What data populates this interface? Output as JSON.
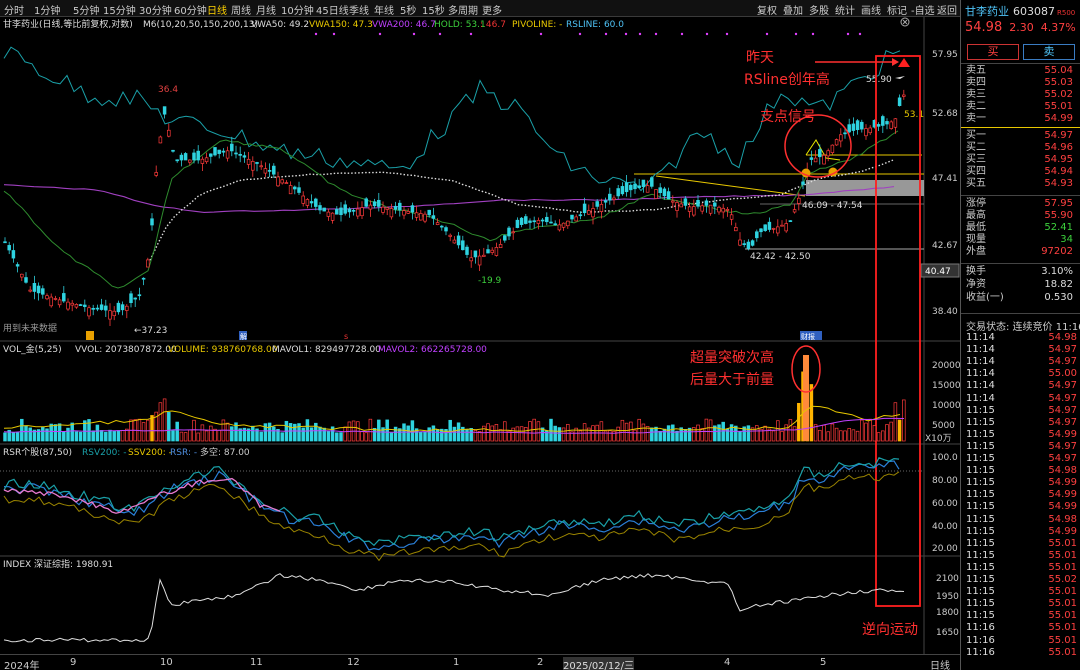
{
  "toolbar": {
    "periods": [
      "分时",
      "1分钟",
      "5分钟",
      "15分钟",
      "30分钟",
      "60分钟",
      "日线",
      "周线",
      "月线",
      "10分钟",
      "45日线",
      "季线",
      "年线",
      "5秒",
      "15秒",
      "多周期",
      "更多"
    ],
    "active": "日线",
    "right": [
      "复权",
      "叠加",
      "多股",
      "统计",
      "画线",
      "标记",
      "-自选",
      "返回"
    ],
    "close_icon": "close-circle-icon"
  },
  "main_legend": {
    "title": "甘李药业(日线,等比前复权,对数)",
    "ma": "M6(10,20,50,150,200,13)",
    "vwa50": "VWA50: 49.2",
    "vwa150": "VWA150: 47.3",
    "vwa200": "VWA200: 46.7",
    "hold": "HOLD: 53.1",
    "hold2": ": 46.7",
    "pivoline": "PIVOLINE: -",
    "rsline": "RSLINE: 60.0"
  },
  "price_axis": [
    "57.95",
    "52.68",
    "47.41",
    "42.67",
    "38.40"
  ],
  "price_tag": "40.47",
  "annotations": {
    "yesterday": "昨天",
    "rsline_high": "RSline创年高",
    "pivot": "支点信号",
    "volume1": "超量突破次高",
    "volume2": "后量大于前量",
    "reverse": "逆向运动"
  },
  "price_labels": {
    "high_left": "36.4",
    "low_left": "←37.23",
    "low_mid": "-19.9",
    "range_upper": "46.09 - 47.54",
    "range_lower": "42.42 - 42.50",
    "recent_high": "55.90",
    "hold_tag": "53.1",
    "future_data": "用到未来数据",
    "mark_jie": "解",
    "mark_caibao": "财报"
  },
  "vol_legend": {
    "title": "VOL_金(5,25)",
    "vvol": "VVOL: 2073807872.00",
    "volume": "VOLUME: 938760768.00",
    "mavol1": "MAVOL1: 829497728.00",
    "mavol2": "MAVOL2: 662265728.00"
  },
  "vol_axis": [
    "20000",
    "15000",
    "10000",
    "5000"
  ],
  "vol_unit": "X10万",
  "rsr_legend": {
    "title": "RSR个股(87,50)",
    "rsv": "RSV200: -",
    "ssv": "SSV200: -",
    "rsr": "RSR: -",
    "ls": "多空: 87.00"
  },
  "rsr_axis": [
    "100.0",
    "80.00",
    "60.00",
    "40.00",
    "20.00"
  ],
  "index_legend": {
    "title": "INDEX 深证综指: 1980.91"
  },
  "index_axis": [
    "2100",
    "1950",
    "1800",
    "1650"
  ],
  "xaxis": [
    "2024年",
    "9",
    "10",
    "11",
    "12",
    "1",
    "2",
    "2025/02/12/三",
    "4",
    "5",
    "日线"
  ],
  "quote": {
    "name": "甘李药业",
    "code": "603087",
    "r500": "R500",
    "price": "54.98",
    "change": "2.30",
    "pct": "4.37%",
    "buy_btn": "买",
    "sell_btn": "卖",
    "asks": [
      {
        "label": "卖五",
        "price": "55.04"
      },
      {
        "label": "卖四",
        "price": "55.03"
      },
      {
        "label": "卖三",
        "price": "55.02"
      },
      {
        "label": "卖二",
        "price": "55.01"
      },
      {
        "label": "卖一",
        "price": "54.99"
      }
    ],
    "bids": [
      {
        "label": "买一",
        "price": "54.97"
      },
      {
        "label": "买二",
        "price": "54.96"
      },
      {
        "label": "买三",
        "price": "54.95"
      },
      {
        "label": "买四",
        "price": "54.94"
      },
      {
        "label": "买五",
        "price": "54.93"
      }
    ],
    "stats1": [
      {
        "label": "涨停",
        "value": "57.95"
      },
      {
        "label": "最高",
        "value": "55.90"
      },
      {
        "label": "最低",
        "value": "52.41"
      },
      {
        "label": "现量",
        "value": "34"
      },
      {
        "label": "外盘",
        "value": "97202"
      }
    ],
    "stats2": [
      {
        "label": "换手",
        "value": "3.10%"
      },
      {
        "label": "净资",
        "value": "18.82"
      },
      {
        "label": "收益(一)",
        "value": "0.530"
      }
    ],
    "status": "交易状态: 连续竞价 11:16"
  },
  "ticks": [
    {
      "t": "11:14",
      "p": "54.98"
    },
    {
      "t": "11:14",
      "p": "54.97"
    },
    {
      "t": "11:14",
      "p": "54.97"
    },
    {
      "t": "11:14",
      "p": "55.00"
    },
    {
      "t": "11:14",
      "p": "54.97"
    },
    {
      "t": "11:14",
      "p": "54.97"
    },
    {
      "t": "11:15",
      "p": "54.97"
    },
    {
      "t": "11:15",
      "p": "54.97"
    },
    {
      "t": "11:15",
      "p": "54.99"
    },
    {
      "t": "11:15",
      "p": "54.97"
    },
    {
      "t": "11:15",
      "p": "54.97"
    },
    {
      "t": "11:15",
      "p": "54.98"
    },
    {
      "t": "11:15",
      "p": "54.99"
    },
    {
      "t": "11:15",
      "p": "54.99"
    },
    {
      "t": "11:15",
      "p": "54.99"
    },
    {
      "t": "11:15",
      "p": "54.98"
    },
    {
      "t": "11:15",
      "p": "54.99"
    },
    {
      "t": "11:15",
      "p": "55.01"
    },
    {
      "t": "11:15",
      "p": "55.01"
    },
    {
      "t": "11:15",
      "p": "55.01"
    },
    {
      "t": "11:15",
      "p": "55.02"
    },
    {
      "t": "11:15",
      "p": "55.01"
    },
    {
      "t": "11:15",
      "p": "55.01"
    },
    {
      "t": "11:15",
      "p": "55.01"
    },
    {
      "t": "11:16",
      "p": "55.01"
    },
    {
      "t": "11:16",
      "p": "55.01"
    },
    {
      "t": "11:16",
      "p": "55.01"
    }
  ]
}
